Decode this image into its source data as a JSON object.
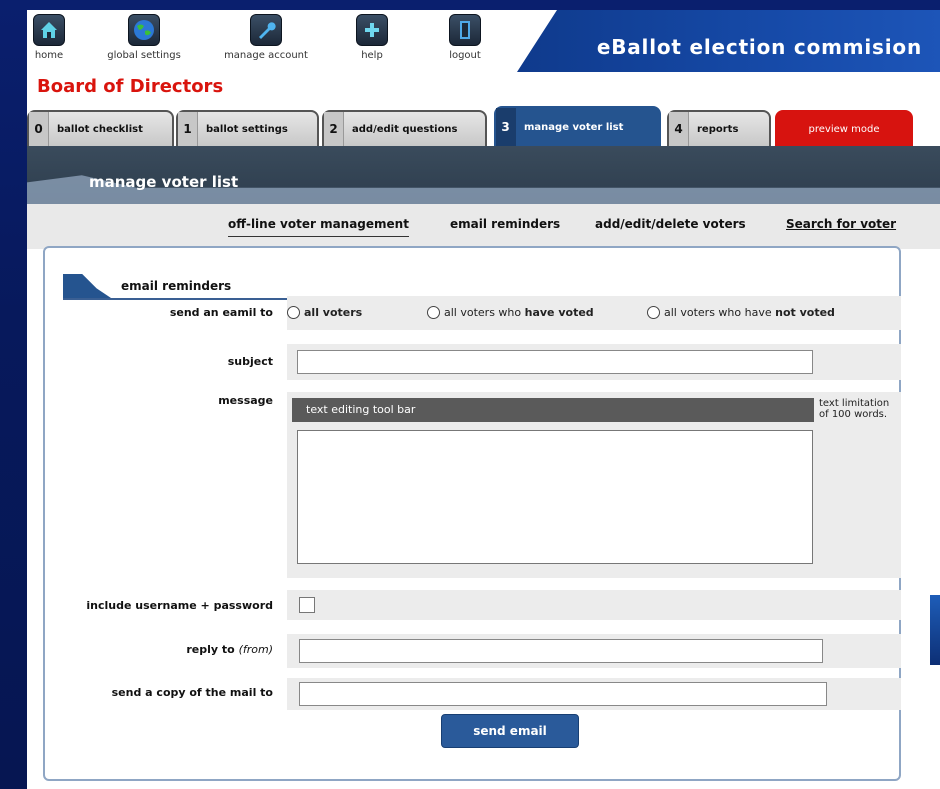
{
  "nav": {
    "items": [
      {
        "label": "home",
        "icon": "home-icon"
      },
      {
        "label": "global settings",
        "icon": "globe-icon"
      },
      {
        "label": "manage account",
        "icon": "wrench-icon"
      },
      {
        "label": "help",
        "icon": "plus-icon"
      },
      {
        "label": "logout",
        "icon": "door-icon"
      }
    ]
  },
  "app_title": "eBallot election commision",
  "board_title": "Board of Directors",
  "tabs": [
    {
      "num": "0",
      "label": "ballot checklist"
    },
    {
      "num": "1",
      "label": "ballot settings"
    },
    {
      "num": "2",
      "label": "add/edit questions"
    },
    {
      "num": "3",
      "label": "manage voter list"
    },
    {
      "num": "4",
      "label": "reports"
    },
    {
      "label": "preview mode"
    }
  ],
  "section_title": "manage voter list",
  "subnav": {
    "offline": "off-line voter management",
    "email": "email reminders",
    "addedit": "add/edit/delete voters",
    "search": "Search for voter"
  },
  "panel": {
    "title": "email reminders",
    "send_to_label": "send an eamil to",
    "options": {
      "all": "all voters",
      "voted_prefix": "all voters who ",
      "voted_bold": "have voted",
      "notvoted_prefix": "all voters who have ",
      "notvoted_bold": "not voted"
    },
    "subject_label": "subject",
    "subject_value": "",
    "message_label": "message",
    "toolbar_text": "text editing tool bar",
    "message_value": "",
    "limit_note": "text limitation of 100 words.",
    "include_label": "include username + password",
    "reply_label": "reply to",
    "reply_hint": "(from)",
    "reply_value": "",
    "copy_label": "send a copy of the mail to",
    "copy_value": "",
    "send_button": "send email"
  },
  "colors": {
    "brand_blue": "#25548f",
    "accent_red": "#d9140d",
    "background": "#0a1f6e"
  }
}
